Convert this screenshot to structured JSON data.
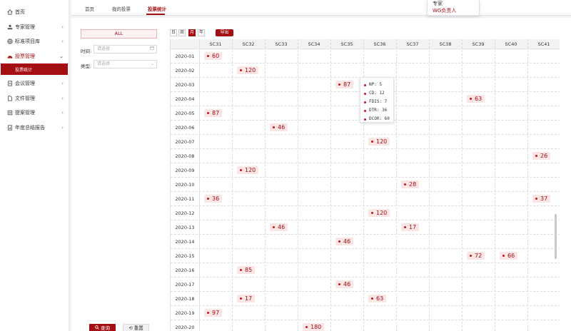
{
  "sidebar": {
    "items": [
      {
        "label": "首页",
        "icon": "home-icon",
        "chevron": false
      },
      {
        "label": "专家管理",
        "icon": "user-upload-icon",
        "chevron": true
      },
      {
        "label": "标准项目库",
        "icon": "globe-icon",
        "chevron": true
      },
      {
        "label": "投票管理",
        "icon": "vote-hat-icon",
        "chevron": true,
        "active": true
      },
      {
        "label": "会议管理",
        "icon": "document-icon",
        "chevron": true
      },
      {
        "label": "文件管理",
        "icon": "file-icon",
        "chevron": true
      },
      {
        "label": "提案管理",
        "icon": "list-icon",
        "chevron": true
      },
      {
        "label": "年度总结报告",
        "icon": "report-icon",
        "chevron": true
      }
    ],
    "submenu": {
      "label": "投票统计"
    }
  },
  "tabs": [
    {
      "label": "首页"
    },
    {
      "label": "我的投票"
    },
    {
      "label": "投票统计",
      "active": true
    }
  ],
  "user_menu": {
    "role": "专家",
    "option": "WG负责人"
  },
  "filter": {
    "all_label": "ALL",
    "time_label": "时间:",
    "time_placeholder": "请选择",
    "type_label": "类型:",
    "type_placeholder": "请选择",
    "query_label": "查询",
    "reset_label": "重置"
  },
  "view_toggle": [
    {
      "label": "日"
    },
    {
      "label": "周"
    },
    {
      "label": "月",
      "active": true
    },
    {
      "label": "年"
    }
  ],
  "export_label": "导出",
  "columns": [
    "SC31",
    "SC32",
    "SC33",
    "SC34",
    "SC35",
    "SC36",
    "SC37",
    "SC38",
    "SC39",
    "SC40",
    "SC41"
  ],
  "rows": [
    {
      "period": "2020-01",
      "cells": [
        {
          "col": 0,
          "value": "60"
        }
      ]
    },
    {
      "period": "2020-02",
      "cells": [
        {
          "col": 1,
          "value": "120"
        }
      ]
    },
    {
      "period": "2020-03",
      "cells": [
        {
          "col": 4,
          "value": "87"
        }
      ]
    },
    {
      "period": "2020-04",
      "cells": [
        {
          "col": 8,
          "value": "63"
        }
      ]
    },
    {
      "period": "2020-05",
      "cells": [
        {
          "col": 0,
          "value": "87"
        }
      ]
    },
    {
      "period": "2020-06",
      "cells": [
        {
          "col": 2,
          "value": "46"
        }
      ]
    },
    {
      "period": "2020-07",
      "cells": [
        {
          "col": 5,
          "value": "120"
        }
      ]
    },
    {
      "period": "2020-08",
      "cells": [
        {
          "col": 10,
          "value": "26"
        }
      ]
    },
    {
      "period": "2020-09",
      "cells": [
        {
          "col": 1,
          "value": "120"
        }
      ]
    },
    {
      "period": "2020-10",
      "cells": [
        {
          "col": 6,
          "value": "28"
        }
      ]
    },
    {
      "period": "2020-11",
      "cells": [
        {
          "col": 0,
          "value": "36"
        },
        {
          "col": 10,
          "value": "37"
        }
      ]
    },
    {
      "period": "2020-12",
      "cells": [
        {
          "col": 5,
          "value": "120"
        }
      ]
    },
    {
      "period": "2020-13",
      "cells": [
        {
          "col": 2,
          "value": "46"
        },
        {
          "col": 6,
          "value": "17"
        }
      ]
    },
    {
      "period": "2020-14",
      "cells": [
        {
          "col": 4,
          "value": "46"
        }
      ]
    },
    {
      "period": "2020-15",
      "cells": [
        {
          "col": 8,
          "value": "72"
        },
        {
          "col": 9,
          "value": "66"
        }
      ]
    },
    {
      "period": "2020-16",
      "cells": [
        {
          "col": 1,
          "value": "85"
        }
      ]
    },
    {
      "period": "2020-17",
      "cells": [
        {
          "col": 4,
          "value": "46"
        }
      ]
    },
    {
      "period": "2020-18",
      "cells": [
        {
          "col": 1,
          "value": "17"
        },
        {
          "col": 5,
          "value": "63"
        }
      ]
    },
    {
      "period": "2020-19",
      "cells": [
        {
          "col": 0,
          "value": "97"
        }
      ]
    },
    {
      "period": "2020-20",
      "cells": [
        {
          "col": 3,
          "value": "180"
        }
      ]
    }
  ],
  "tooltip": {
    "items": [
      "NP: 5",
      "CD: 12",
      "FDIS: 7",
      "DTR: 36",
      "DCOR: 60"
    ]
  },
  "colors": {
    "accent": "#a40d11",
    "chip_bg": "#fbe6e6"
  }
}
